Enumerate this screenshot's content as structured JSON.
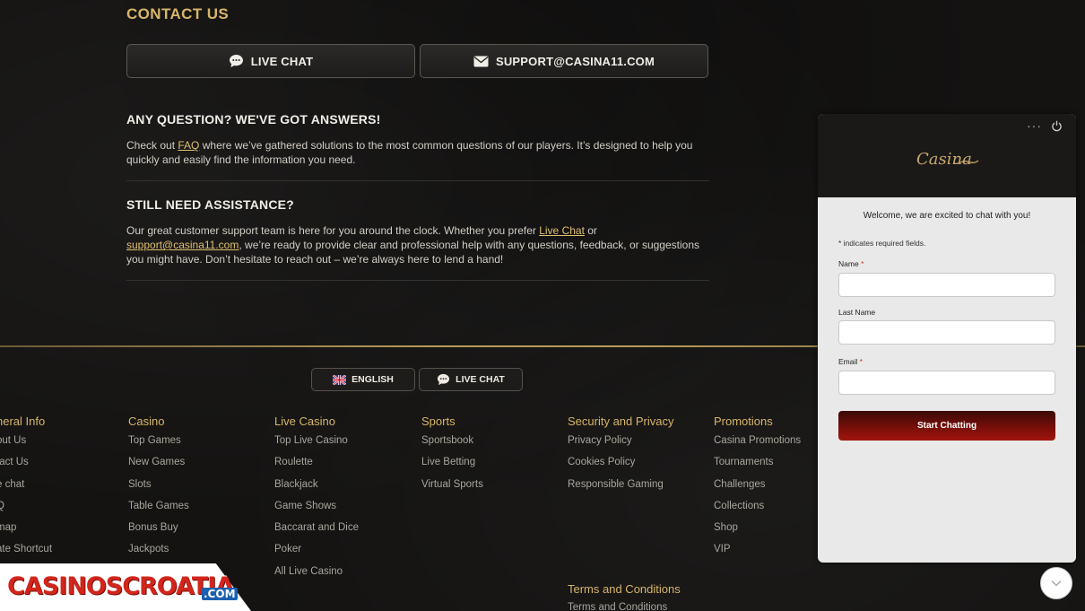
{
  "contact": {
    "title": "CONTACT US",
    "live_chat_label": "LIVE CHAT",
    "email_label": "SUPPORT@CASINA11.COM"
  },
  "faq_section": {
    "heading": "ANY QUESTION? WE'VE GOT ANSWERS!",
    "text_before": "Check out ",
    "link": "FAQ",
    "text_after": " where we’ve gathered solutions to the most common questions of our players. It’s designed to help you quickly and easily find the information you need."
  },
  "assist_section": {
    "heading": "STILL NEED ASSISTANCE?",
    "text_1": "Our great customer support team is here for you around the clock. Whether you prefer ",
    "link_chat": "Live Chat",
    "text_2": " or ",
    "link_email": "support@casina11.com",
    "text_3": ", we’re ready to provide clear and professional help with any questions, feedback, or suggestions you might have. Don’t hesitate to reach out – we’re always here to lend a hand!"
  },
  "footer_pills": {
    "language": "ENGLISH",
    "live_chat": "LIVE CHAT"
  },
  "footer_columns": [
    {
      "title": "neral Info",
      "items": [
        "out Us",
        "tact Us",
        "e chat",
        "Q",
        "map",
        "ate Shortcut"
      ]
    },
    {
      "title": "Casino",
      "items": [
        "Top Games",
        "New Games",
        "Slots",
        "Table Games",
        "Bonus Buy",
        "Jackpots"
      ]
    },
    {
      "title": "Live Casino",
      "items": [
        "Top Live Casino",
        "Roulette",
        "Blackjack",
        "Game Shows",
        "Baccarat and Dice",
        "Poker",
        "All Live Casino"
      ]
    },
    {
      "title": "Sports",
      "items": [
        "Sportsbook",
        "Live Betting",
        "Virtual Sports"
      ]
    },
    {
      "title": "Security and Privacy",
      "items": [
        "Privacy Policy",
        "Cookies Policy",
        "Responsible Gaming"
      ]
    },
    {
      "title": "Promotions",
      "items": [
        "Casina Promotions",
        "Tournaments",
        "Challenges",
        "Collections",
        "Shop",
        "VIP"
      ]
    }
  ],
  "terms": {
    "title": "Terms and Conditions",
    "item": "Terms and Conditions"
  },
  "chat_widget": {
    "logo": "Casina",
    "menu": "···",
    "welcome": "Welcome, we are excited to chat with you!",
    "required_note": "* indicates required fields.",
    "name_label": "Name",
    "last_name_label": "Last Name",
    "email_label": "Email",
    "required_mark": "*",
    "submit_label": "Start Chatting"
  },
  "watermark": {
    "text": "CASINOSCROATIA",
    "suffix": ".COM"
  },
  "colors": {
    "accent_gold": "#d8b56a",
    "background": "#141312",
    "chat_button": "#7c0f0a"
  }
}
